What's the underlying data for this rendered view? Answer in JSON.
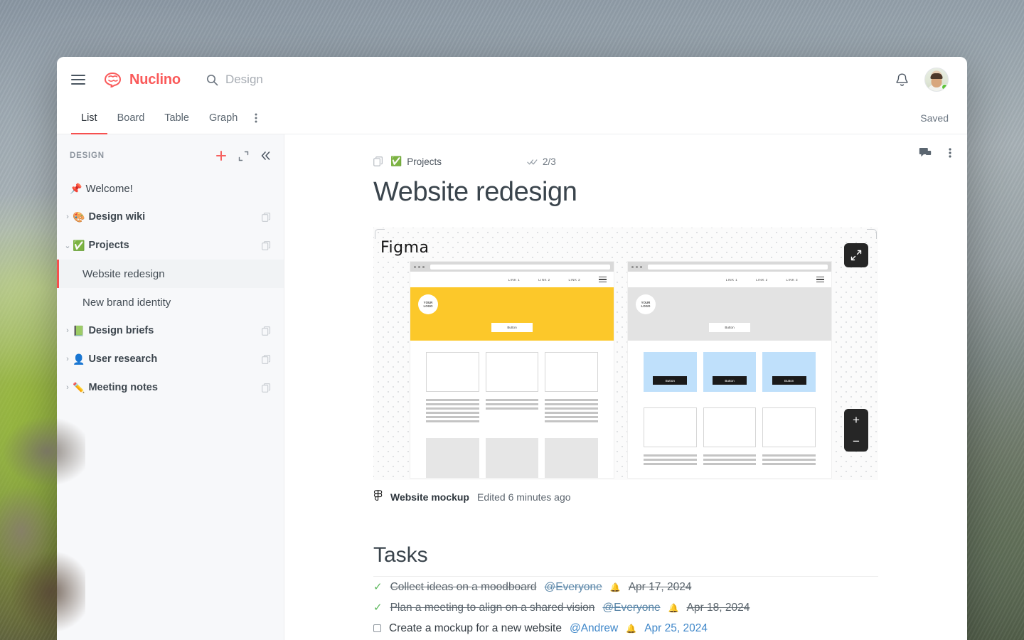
{
  "app": {
    "brand_name": "Nuclino",
    "brand_color": "#fa5a5a",
    "accent_color": "#f6504f"
  },
  "topbar": {
    "menu_icon": "hamburger-icon",
    "logo_icon": "nuclino-brain-logo",
    "search_icon": "search-icon",
    "search_value": "Design",
    "search_placeholder": "Search",
    "notifications_icon": "bell-icon",
    "avatar_icon": "user-avatar",
    "status": "online"
  },
  "tabs": {
    "items": [
      {
        "label": "List",
        "active": true
      },
      {
        "label": "Board",
        "active": false
      },
      {
        "label": "Table",
        "active": false
      },
      {
        "label": "Graph",
        "active": false
      }
    ],
    "more_icon": "kebab-menu-icon",
    "save_status": "Saved"
  },
  "sidebar": {
    "title": "DESIGN",
    "actions": [
      {
        "name": "add-item-button",
        "icon": "plus-icon"
      },
      {
        "name": "expand-all-button",
        "icon": "expand-icon"
      },
      {
        "name": "collapse-sidebar-button",
        "icon": "chevrons-left-icon"
      }
    ],
    "items": [
      {
        "label": "Welcome!",
        "emoji": "📌",
        "kind": "pinned",
        "caret": "",
        "trailing": "",
        "selected": false
      },
      {
        "label": "Design wiki",
        "emoji": "🎨",
        "kind": "collection",
        "caret": "›",
        "trailing": "duplicate-icon",
        "selected": false
      },
      {
        "label": "Projects",
        "emoji": "✅",
        "kind": "collection",
        "caret": "⌄",
        "trailing": "duplicate-icon",
        "selected": false
      },
      {
        "label": "Website redesign",
        "emoji": "",
        "kind": "child",
        "caret": "",
        "trailing": "",
        "selected": true
      },
      {
        "label": "New brand identity",
        "emoji": "",
        "kind": "child",
        "caret": "",
        "trailing": "",
        "selected": false
      },
      {
        "label": "Design briefs",
        "emoji": "📗",
        "kind": "collection",
        "caret": "›",
        "trailing": "duplicate-icon",
        "selected": false
      },
      {
        "label": "User research",
        "emoji": "👤",
        "kind": "collection",
        "caret": "›",
        "trailing": "duplicate-icon",
        "selected": false
      },
      {
        "label": "Meeting notes",
        "emoji": "✏️",
        "kind": "collection",
        "caret": "›",
        "trailing": "duplicate-icon",
        "selected": false
      }
    ]
  },
  "document": {
    "actions": [
      {
        "name": "comments-button",
        "icon": "comment-bubble-icon"
      },
      {
        "name": "document-menu-button",
        "icon": "kebab-menu-icon"
      }
    ],
    "breadcrumb_emoji": "✅",
    "breadcrumb_label": "Projects",
    "breadcrumb_icon": "duplicate-icon",
    "progress_icon": "double-check-icon",
    "progress_label": "2/3",
    "title": "Website redesign"
  },
  "embed": {
    "provider_label": "Figma",
    "expand_icon": "fullscreen-expand-icon",
    "zoom_in_label": "+",
    "zoom_out_label": "−",
    "caption_icon": "figma-logo-icon",
    "caption_name": "Website mockup",
    "caption_sub": "Edited 6 minutes ago",
    "colors": {
      "hero_yellow": "#fcc82a",
      "hero_grey": "#e3e3e3",
      "card_blue": "#bfe0fb",
      "card_grey": "#e6e6e6",
      "button_dark": "#1a1a1a"
    },
    "frames": [
      {
        "nav_links": [
          "LINK 1",
          "LINK 2",
          "LINK 3"
        ],
        "logo_line1": "YOUR",
        "logo_line2": "LOGO",
        "hero_button": "Button",
        "row1_style": "outline",
        "row2_style": "grey",
        "card_buttons": []
      },
      {
        "nav_links": [
          "LINK 1",
          "LINK 2",
          "LINK 3"
        ],
        "logo_line1": "YOUR",
        "logo_line2": "LOGO",
        "hero_button": "Button",
        "row1_style": "blue",
        "row2_style": "outline",
        "card_buttons": [
          "Button",
          "Button",
          "Button"
        ]
      }
    ]
  },
  "tasks": {
    "heading": "Tasks",
    "items": [
      {
        "done": true,
        "text": "Collect ideas on a moodboard",
        "mention": "@Everyone",
        "bell": "🔔",
        "date": "Apr 17, 2024"
      },
      {
        "done": true,
        "text": "Plan a meeting to align on a shared vision",
        "mention": "@Everyone",
        "bell": "🔔",
        "date": "Apr 18, 2024"
      },
      {
        "done": false,
        "text": "Create a mockup for a new website",
        "mention": "@Andrew",
        "bell": "🔔",
        "date": "Apr 25, 2024"
      }
    ]
  }
}
